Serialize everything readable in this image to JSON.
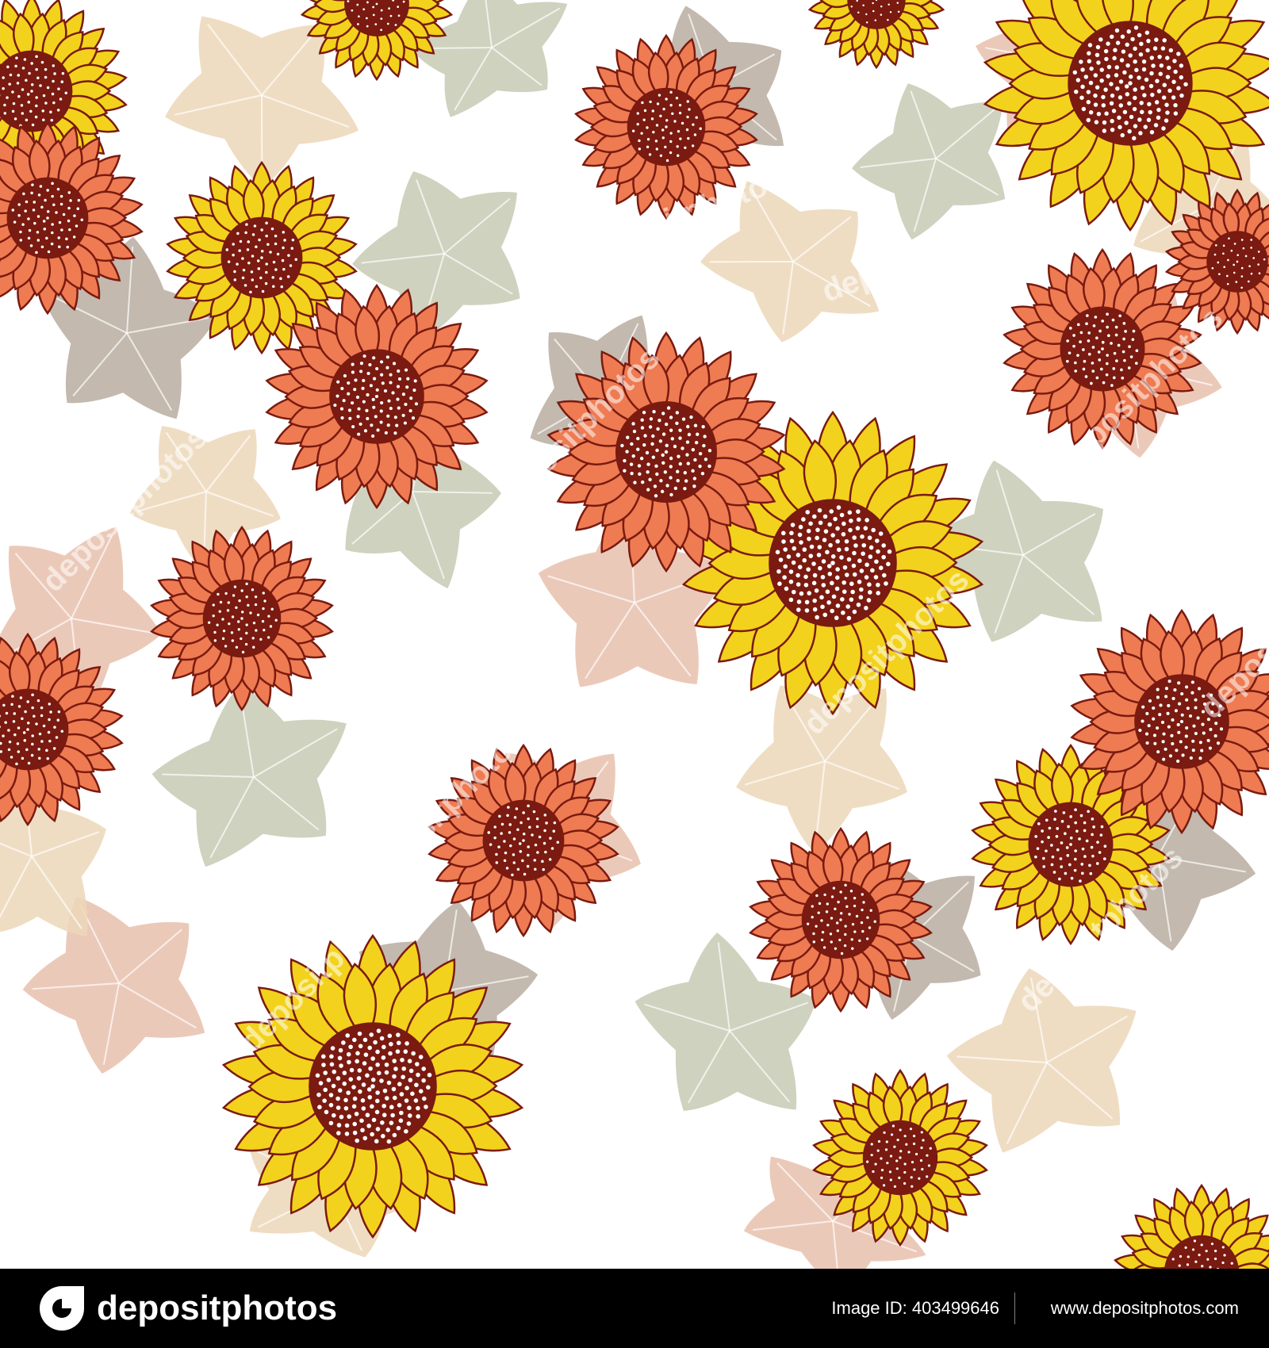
{
  "image": {
    "watermark_text": "depositphotos"
  },
  "footer": {
    "brand": "depositphotos",
    "image_id": "Image ID: 403499646",
    "site": "www.depositphotos.com"
  },
  "colors": {
    "background": "#ffffff",
    "footer_bg": "#000000",
    "yellow_petal": "#f2d21c",
    "orange_petal": "#ee7b52",
    "outline": "#7a1a10",
    "seed_center": "#7a1a10",
    "leaf_sage": "#c7cab3",
    "leaf_pink": "#e8c0ad",
    "leaf_beige": "#ecd7b8",
    "leaf_taupe": "#b8ada0"
  }
}
